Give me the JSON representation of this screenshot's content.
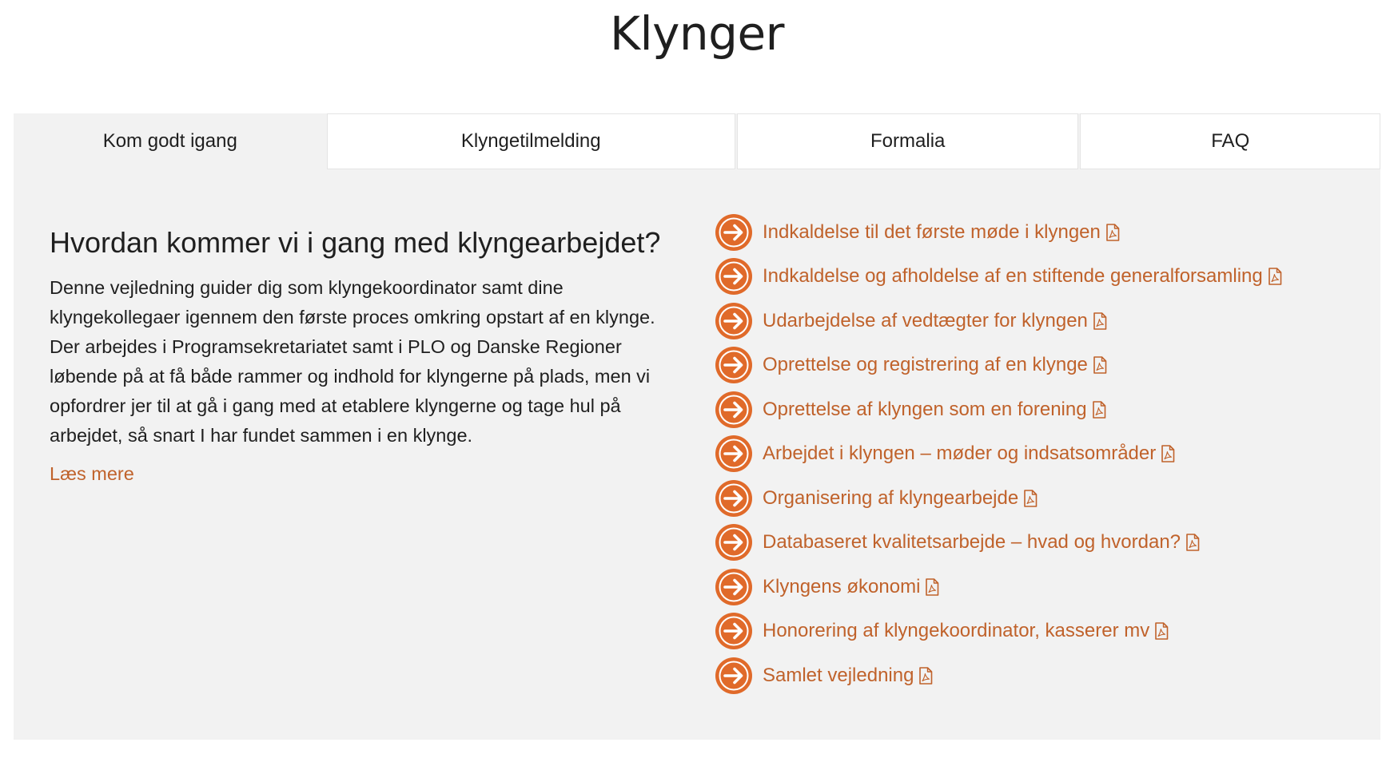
{
  "page": {
    "title": "Klynger"
  },
  "tabs": [
    {
      "label": "Kom godt igang"
    },
    {
      "label": "Klyngetilmelding"
    },
    {
      "label": "Formalia"
    },
    {
      "label": "FAQ"
    }
  ],
  "intro": {
    "heading": "Hvordan kommer vi i gang med klyngearbejdet?",
    "body": "Denne vejledning guider dig som klyngekoordinator samt dine klyngekollegaer igennem den første proces omkring opstart af en klynge. Der arbejdes i Programsekretariatet samt i PLO og Danske Regioner løbende på at få både rammer og indhold for klyngerne på plads, men vi opfordrer jer til at gå i gang med at etablere klyngerne og tage hul på arbejdet, så snart I har fundet sammen i en klynge.",
    "read_more": "Læs mere"
  },
  "documents": [
    {
      "label": "Indkaldelse til det første møde i klyngen"
    },
    {
      "label": "Indkaldelse og afholdelse af en stiftende generalforsamling"
    },
    {
      "label": "Udarbejdelse af vedtægter for klyngen"
    },
    {
      "label": "Oprettelse og registrering af en klynge"
    },
    {
      "label": "Oprettelse af klyngen som en forening"
    },
    {
      "label": "Arbejdet i klyngen – møder og indsatsområder"
    },
    {
      "label": "Organisering af klyngearbejde"
    },
    {
      "label": "Databaseret kvalitetsarbejde – hvad og hvordan?"
    },
    {
      "label": "Klyngens økonomi"
    },
    {
      "label": "Honorering af klyngekoordinator, kasserer mv"
    },
    {
      "label": "Samlet vejledning"
    }
  ],
  "icons": {
    "list_icon": "arrow-right-circle-icon",
    "file_icon": "pdf-file-icon"
  },
  "colors": {
    "accent": "#e06a2a",
    "link": "#c0622b",
    "panel_background": "#f2f2f2"
  }
}
